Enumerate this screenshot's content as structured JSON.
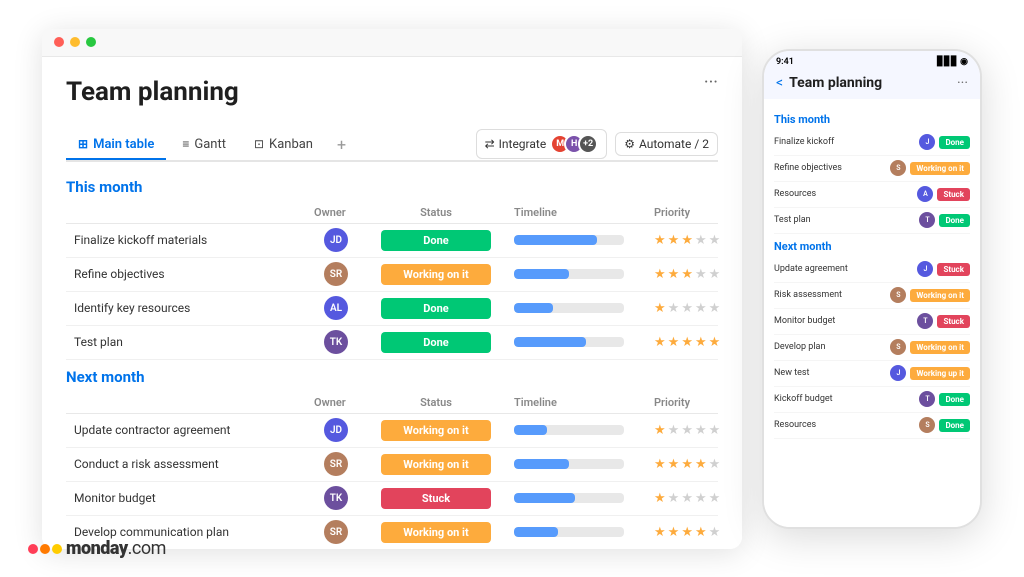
{
  "app": {
    "title": "Team planning",
    "dots_label": "···",
    "tabs": [
      {
        "id": "main-table",
        "label": "Main table",
        "icon": "⊞",
        "active": true
      },
      {
        "id": "gantt",
        "label": "Gantt",
        "icon": "≡",
        "active": false
      },
      {
        "id": "kanban",
        "label": "Kanban",
        "icon": "⊡",
        "active": false
      }
    ],
    "tab_plus": "+",
    "integrate_label": "Integrate",
    "automate_label": "Automate / 2"
  },
  "this_month": {
    "title": "This month",
    "owner_col": "Owner",
    "status_col": "Status",
    "timeline_col": "Timeline",
    "priority_col": "Priority",
    "rows": [
      {
        "task": "Finalize kickoff materials",
        "avatar_color": "#5559df",
        "avatar_initials": "JD",
        "status": "Done",
        "status_class": "status-done",
        "timeline_pct": 75,
        "stars_filled": 3,
        "stars_total": 5
      },
      {
        "task": "Refine objectives",
        "avatar_color": "#b47e5e",
        "avatar_initials": "SR",
        "status": "Working on it",
        "status_class": "status-working",
        "timeline_pct": 50,
        "stars_filled": 3,
        "stars_total": 5
      },
      {
        "task": "Identify key resources",
        "avatar_color": "#5559df",
        "avatar_initials": "AL",
        "status": "Done",
        "status_class": "status-done",
        "timeline_pct": 35,
        "stars_filled": 1,
        "stars_total": 5
      },
      {
        "task": "Test plan",
        "avatar_color": "#6c4f9e",
        "avatar_initials": "TK",
        "status": "Done",
        "status_class": "status-done",
        "timeline_pct": 65,
        "stars_filled": 5,
        "stars_total": 5
      }
    ]
  },
  "next_month": {
    "title": "Next month",
    "owner_col": "Owner",
    "status_col": "Status",
    "timeline_col": "Timeline",
    "priority_col": "Priority",
    "rows": [
      {
        "task": "Update contractor agreement",
        "avatar_color": "#5559df",
        "avatar_initials": "JD",
        "status": "Working on it",
        "status_class": "status-working",
        "timeline_pct": 30,
        "stars_filled": 1,
        "stars_total": 5
      },
      {
        "task": "Conduct a risk assessment",
        "avatar_color": "#b47e5e",
        "avatar_initials": "SR",
        "status": "Working on it",
        "status_class": "status-working",
        "timeline_pct": 50,
        "stars_filled": 4,
        "stars_total": 5
      },
      {
        "task": "Monitor budget",
        "avatar_color": "#6c4f9e",
        "avatar_initials": "TK",
        "status": "Stuck",
        "status_class": "status-stuck",
        "timeline_pct": 55,
        "stars_filled": 1,
        "stars_total": 5
      },
      {
        "task": "Develop communication plan",
        "avatar_color": "#b47e5e",
        "avatar_initials": "SR",
        "status": "Working on it",
        "status_class": "status-working",
        "timeline_pct": 40,
        "stars_filled": 4,
        "stars_total": 5
      }
    ]
  },
  "mobile": {
    "time": "9:41",
    "title": "Team planning",
    "back_label": "<",
    "dots_label": "···",
    "this_month_label": "This month",
    "next_month_label": "Next month",
    "this_month_rows": [
      {
        "task": "Finalize kickoff",
        "avatar_color": "#5559df",
        "status": "Done",
        "status_class": "status-done"
      },
      {
        "task": "Refine objectives",
        "avatar_color": "#b47e5e",
        "status": "Working on it",
        "status_class": "status-working"
      },
      {
        "task": "Resources",
        "avatar_color": "#5559df",
        "status": "Stuck",
        "status_class": "status-stuck"
      },
      {
        "task": "Test plan",
        "avatar_color": "#6c4f9e",
        "status": "Done",
        "status_class": "status-done"
      }
    ],
    "next_month_rows": [
      {
        "task": "Update agreement",
        "avatar_color": "#5559df",
        "status": "Stuck",
        "status_class": "status-stuck"
      },
      {
        "task": "Risk assessment",
        "avatar_color": "#b47e5e",
        "status": "Working on it",
        "status_class": "status-working"
      },
      {
        "task": "Monitor budget",
        "avatar_color": "#6c4f9e",
        "status": "Stuck",
        "status_class": "status-stuck"
      },
      {
        "task": "Develop plan",
        "avatar_color": "#b47e5e",
        "status": "Working on it",
        "status_class": "status-working"
      },
      {
        "task": "New test",
        "avatar_color": "#5559df",
        "status": "Working up it",
        "status_class": "status-working"
      },
      {
        "task": "Kickoff budget",
        "avatar_color": "#6c4f9e",
        "status": "Done",
        "status_class": "status-done"
      },
      {
        "task": "Resources",
        "avatar_color": "#b47e5e",
        "status": "Done",
        "status_class": "status-done"
      }
    ]
  },
  "logo": {
    "text": "monday",
    "com": ".com"
  }
}
